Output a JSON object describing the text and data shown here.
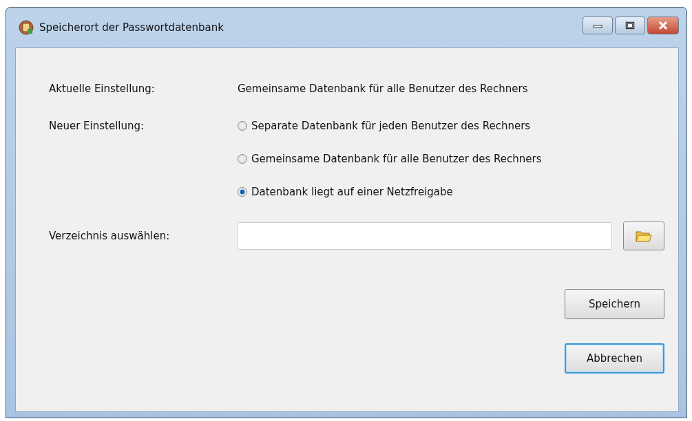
{
  "window": {
    "title": "Speicherort der Passwortdatenbank"
  },
  "current": {
    "label": "Aktuelle Einstellung:",
    "value": "Gemeinsame Datenbank für alle Benutzer des Rechners"
  },
  "new_setting": {
    "label": "Neuer Einstellung:",
    "options": [
      {
        "label": "Separate Datenbank für jeden Benutzer des Rechners",
        "selected": false
      },
      {
        "label": "Gemeinsame Datenbank für alle Benutzer des Rechners",
        "selected": false
      },
      {
        "label": "Datenbank liegt auf einer Netzfreigabe",
        "selected": true
      }
    ]
  },
  "directory": {
    "label": "Verzeichnis auswählen:"
  },
  "buttons": [
    {
      "label": "Speichern",
      "focused": false
    },
    {
      "label": "Abbrechen",
      "focused": true
    }
  ]
}
